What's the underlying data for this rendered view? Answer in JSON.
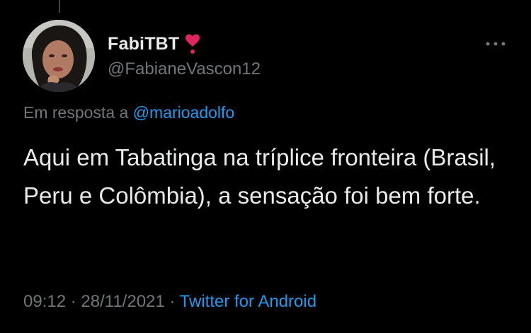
{
  "tweet": {
    "display_name": "FabiTBT",
    "name_emoji": "heart-exclamation-icon",
    "handle": "@FabianeVascon12",
    "reply_prefix": "Em resposta a",
    "reply_mention": "@marioadolfo",
    "text": "Aqui em Tabatinga na tríplice fronteira (Brasil, Peru e Colômbia), a sensação foi bem forte.",
    "time": "09:12",
    "separator": "·",
    "date": "28/11/2021",
    "source": "Twitter for Android"
  },
  "colors": {
    "background": "#000000",
    "primary_text": "#e7e9ea",
    "secondary_text": "#71767b",
    "accent": "#1d9bf0",
    "heart": "#e0245e"
  }
}
